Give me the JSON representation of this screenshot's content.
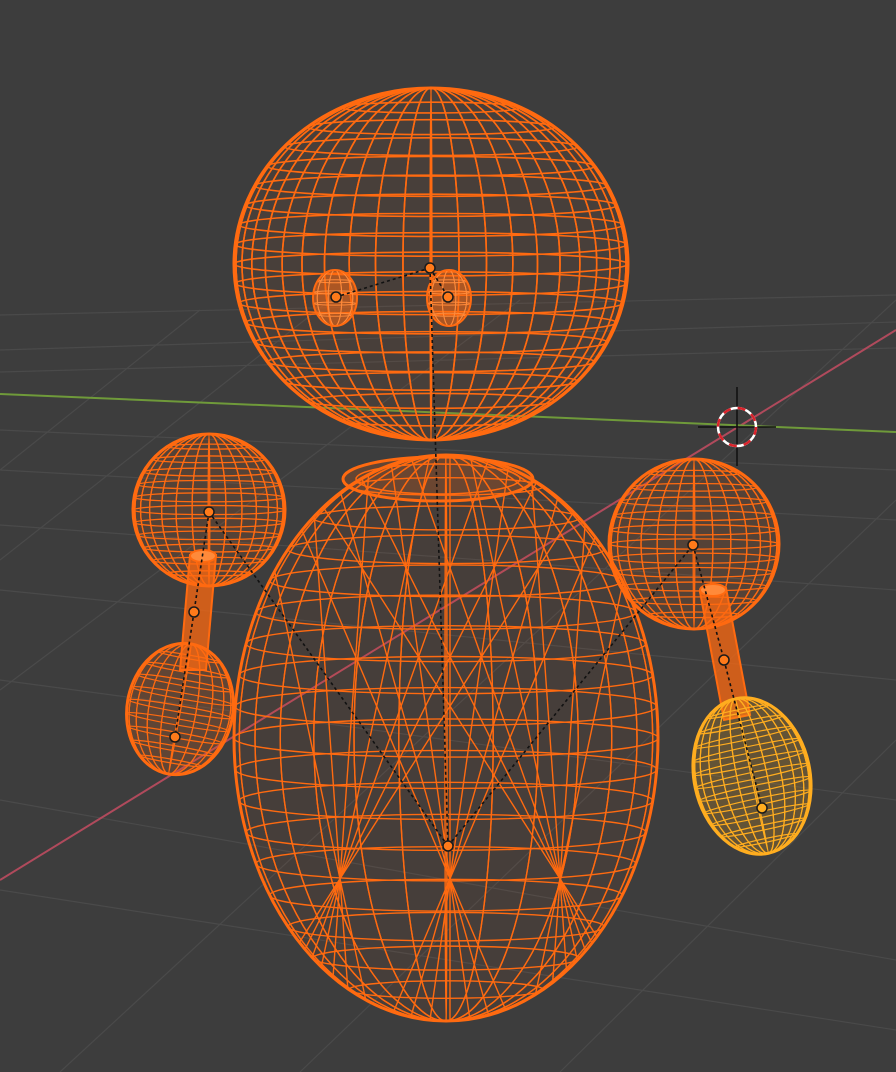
{
  "viewport": {
    "mode": "wireframe",
    "background_color": "#3d3d3d",
    "grid_color": "#4a4a4a",
    "x_axis_color": "#b04a5c",
    "y_axis_color": "#6f9a3a",
    "selection_color": "#ff6a10",
    "active_color": "#ffad1f",
    "origin_dot_color": "#ff7a1a",
    "relationship_line_color": "#111111"
  },
  "scene": {
    "objects": [
      {
        "name": "head",
        "icon": "wireframe-sphere",
        "selected": true,
        "active": false
      },
      {
        "name": "eye-left",
        "icon": "wireframe-ellipsoid",
        "selected": true,
        "active": false
      },
      {
        "name": "eye-right",
        "icon": "wireframe-ellipsoid",
        "selected": true,
        "active": false
      },
      {
        "name": "body",
        "icon": "wireframe-ellipsoid",
        "selected": true,
        "active": false
      },
      {
        "name": "shoulder-left",
        "icon": "wireframe-sphere",
        "selected": true,
        "active": false
      },
      {
        "name": "arm-left",
        "icon": "wireframe-cylinder",
        "selected": true,
        "active": false
      },
      {
        "name": "hand-left",
        "icon": "wireframe-ellipsoid",
        "selected": true,
        "active": false
      },
      {
        "name": "shoulder-right",
        "icon": "wireframe-sphere",
        "selected": true,
        "active": false
      },
      {
        "name": "arm-right",
        "icon": "wireframe-cylinder",
        "selected": true,
        "active": false
      },
      {
        "name": "hand-right",
        "icon": "wireframe-ellipsoid",
        "selected": true,
        "active": true
      }
    ],
    "cursor_icon": "3d-cursor-icon"
  }
}
